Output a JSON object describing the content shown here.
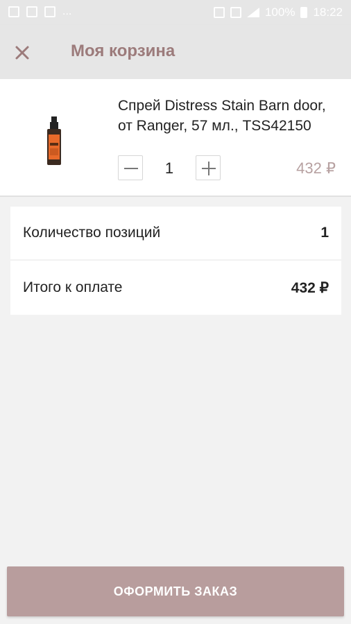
{
  "status_bar": {
    "left_text": "...",
    "battery": "100%",
    "time": "18:22"
  },
  "app_bar": {
    "title": "Моя корзина",
    "close_icon": "close-icon"
  },
  "cart": {
    "items": [
      {
        "title": "Спрей Distress Stain Barn door, от Ranger, 57 мл., TSS42150",
        "quantity": "1",
        "price": "432 ₽"
      }
    ]
  },
  "summary": {
    "positions_label": "Количество позиций",
    "positions_value": "1",
    "total_label": "Итого к оплате",
    "total_value": "432 ₽"
  },
  "checkout": {
    "label": "ОФОРМИТЬ ЗАКАЗ"
  },
  "colors": {
    "brand": "#b89d9d",
    "title": "#9c7b7b",
    "price": "#b7a1a1"
  }
}
